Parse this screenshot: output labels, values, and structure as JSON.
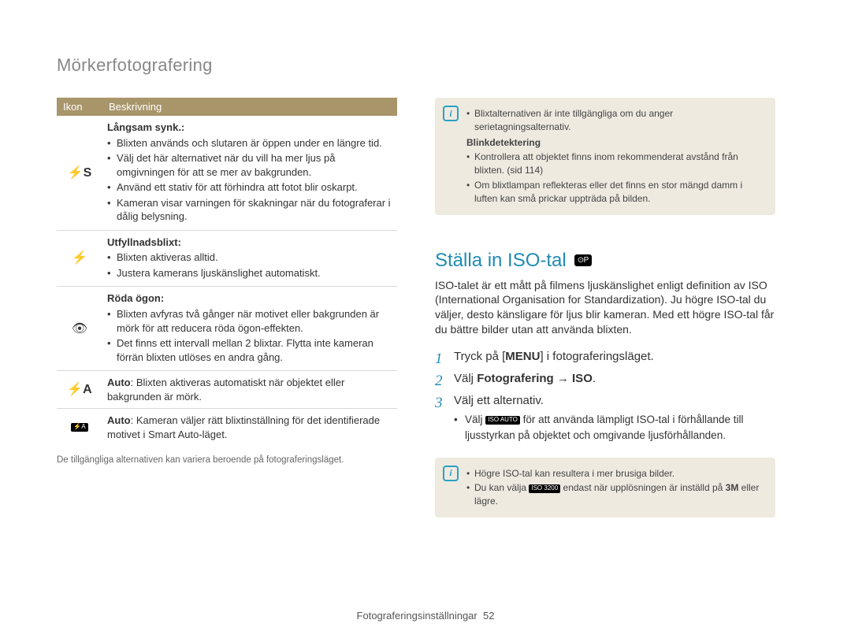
{
  "page_title": "Mörkerfotografering",
  "table": {
    "head": {
      "icon": "Ikon",
      "desc": "Beskrivning"
    },
    "rows": [
      {
        "icon_name": "flash-slow-sync-icon",
        "icon_glyph": "⚡S",
        "title": "Långsam synk.:",
        "bullets": [
          "Blixten används och slutaren är öppen under en längre tid.",
          "Välj det här alternativet när du vill ha mer ljus på omgivningen för att se mer av bakgrunden.",
          "Använd ett stativ för att förhindra att fotot blir oskarpt.",
          "Kameran visar varningen för skakningar  när du fotograferar i dålig belysning."
        ]
      },
      {
        "icon_name": "flash-fill-icon",
        "icon_glyph": "⚡",
        "title": "Utfyllnadsblixt:",
        "bullets": [
          "Blixten aktiveras alltid.",
          "Justera kamerans ljuskänslighet automatiskt."
        ]
      },
      {
        "icon_name": "red-eye-icon",
        "icon_glyph": "👁",
        "title": "Röda ögon:",
        "bullets": [
          "Blixten avfyras två gånger när motivet eller bakgrunden är mörk för att reducera röda ögon-effekten.",
          "Det finns ett intervall mellan 2 blixtar. Flytta inte kameran förrän blixten utlöses en andra gång."
        ]
      },
      {
        "icon_name": "flash-auto-icon",
        "icon_glyph": "⚡A",
        "title": "Auto",
        "desc": ": Blixten aktiveras automatiskt när objektet eller bakgrunden är mörk."
      },
      {
        "icon_name": "flash-smart-auto-icon",
        "icon_glyph": "⚡A",
        "title": "Auto",
        "desc": ": Kameran väljer rätt blixtinställning för det identifierade motivet i Smart Auto-läget."
      }
    ]
  },
  "footnote": "De tillgängliga alternativen kan variera beroende på fotograferingsläget.",
  "note1": {
    "bullets_top": "Blixtalternativen är inte tillgängliga om du anger serietagningsalternativ.",
    "sub_heading": "Blinkdetektering",
    "bullets_sub": [
      "Kontrollera att objektet finns inom rekommenderat avstånd från blixten. (sid 114)",
      "Om blixtlampan reflekteras eller det finns en stor mängd damm i luften kan små prickar uppträda på bilden."
    ]
  },
  "iso": {
    "heading": "Ställa in ISO-tal",
    "para": "ISO-talet är ett mått på filmens ljuskänslighet enligt definition av ISO (International Organisation for Standardization).\nJu högre ISO-tal du väljer, desto känsligare för ljus blir kameran. Med ett högre ISO-tal får du bättre bilder utan att använda blixten.",
    "steps": {
      "s1_pre": "Tryck på [",
      "s1_menu": "MENU",
      "s1_post": "] i fotograferingsläget.",
      "s2_pre": "Välj ",
      "s2_bold": "Fotografering → ISO",
      "s2_post": ".",
      "s3": "Välj ett alternativ.",
      "s3_sub_pre": "Välj ",
      "s3_sub_icon": "ISO AUTO",
      "s3_sub_post": " för att använda lämpligt ISO-tal i förhållande till ljusstyrkan på objektet och omgivande ljusförhållanden."
    }
  },
  "note2": {
    "b1": "Högre ISO-tal kan resultera i mer brusiga bilder.",
    "b2_pre": "Du kan välja ",
    "b2_icon": "ISO 3200",
    "b2_mid": " endast när upplösningen är inställd på ",
    "b2_res": "3M",
    "b2_post": " eller lägre."
  },
  "footer": {
    "label": "Fotograferingsinställningar",
    "page": "52"
  }
}
